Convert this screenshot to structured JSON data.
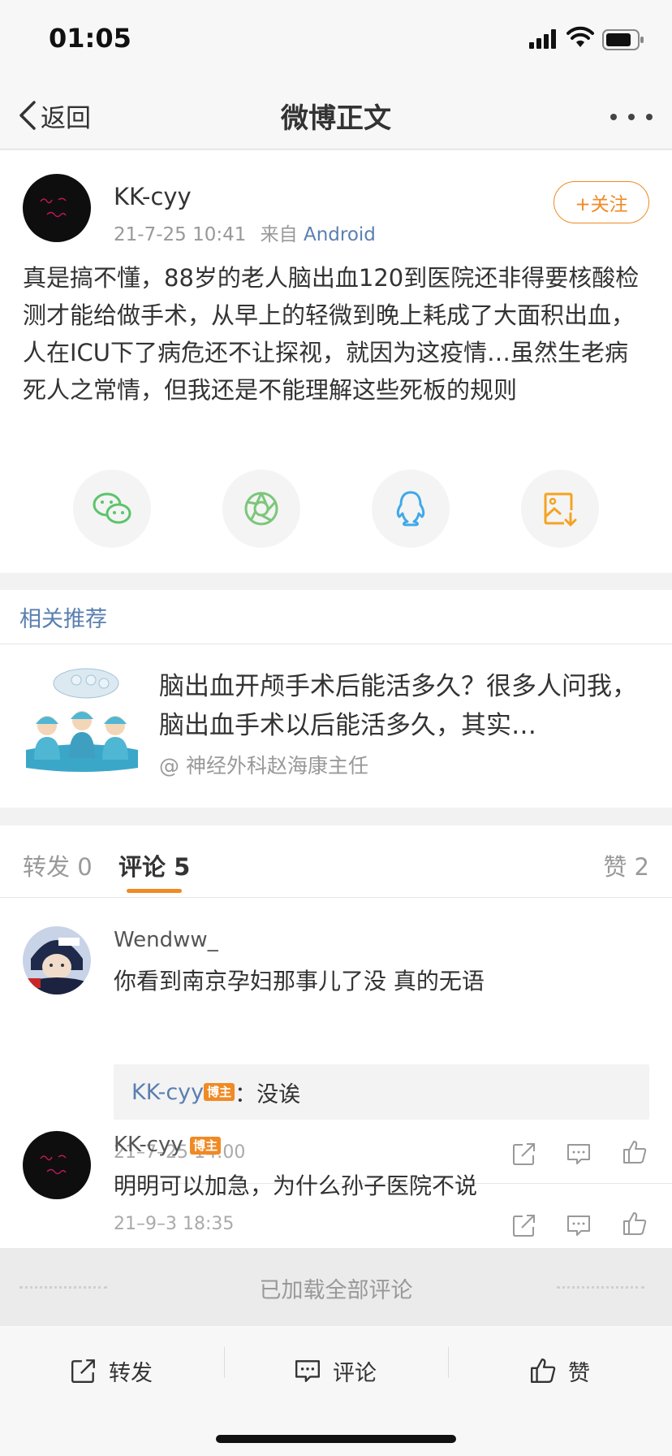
{
  "status_bar": {
    "time": "01:05"
  },
  "nav": {
    "back_label": "返回",
    "title": "微博正文"
  },
  "post": {
    "author": "KK-cyy",
    "timestamp": "21-7-25 10:41",
    "source_prefix": "来自",
    "source": "Android",
    "follow_label": "+关注",
    "text": "真是搞不懂，88岁的老人脑出血120到医院还非得要核酸检测才能给做手术，从早上的轻微到晚上耗成了大面积出血，人在ICU下了病危还不让探视，就因为这疫情…虽然生老病死人之常情，但我还是不能理解这些死板的规则",
    "share_targets": [
      "wechat-icon",
      "moments-icon",
      "qq-icon",
      "save-image-icon"
    ]
  },
  "related": {
    "title": "相关推荐",
    "card_text": "脑出血开颅手术后能活多久？很多人问我，脑出血手术以后能活多久，其实…",
    "card_source": "@ 神经外科赵海康主任"
  },
  "tabs": {
    "repost": "转发 0",
    "comments": "评论 5",
    "likes": "赞 2"
  },
  "comments": [
    {
      "name": "Wendww_",
      "text": "你看到南京孕妇那事儿了没 真的无语",
      "reply_author": "KK-cyy",
      "reply_badge": "博主",
      "reply_text": "：没诶",
      "time": "21–7–25 14:00"
    },
    {
      "name": "KK-cyy",
      "badge": "博主",
      "text": "明明可以加急，为什么孙子医院不说",
      "time": "21–9–3 18:35"
    }
  ],
  "loaded_text": "已加载全部评论",
  "toolbar": {
    "repost": "转发",
    "comment": "评论",
    "like": "赞"
  },
  "colors": {
    "accent": "#f08a24",
    "link": "#5a7fb0"
  }
}
